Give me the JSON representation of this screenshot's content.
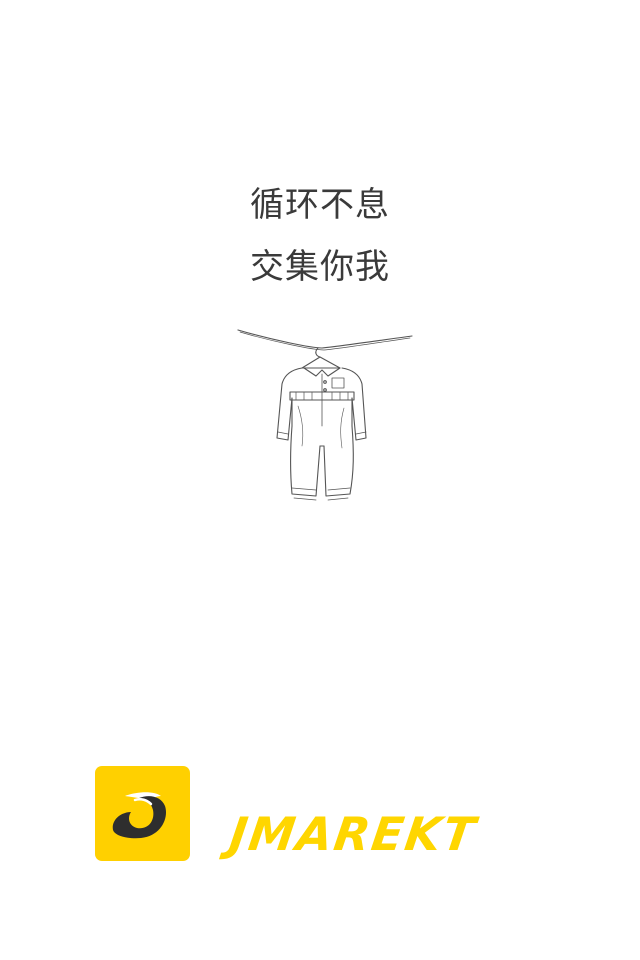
{
  "screen": "launch-splash",
  "slogan": {
    "line1": "循环不息",
    "line2": "交集你我"
  },
  "illustration": {
    "icon": "hanging-jumpsuit-illustration"
  },
  "brand": {
    "logo_letter": "J",
    "logo_icon": "app-logo-icon",
    "wordmark": "JMAREKT"
  },
  "colors": {
    "background": "#ffffff",
    "slogan_text": "#3a3a3a",
    "brand_yellow": "#ffd000",
    "wordmark_yellow": "#ffd600",
    "logo_dark": "#2e2e2e"
  }
}
